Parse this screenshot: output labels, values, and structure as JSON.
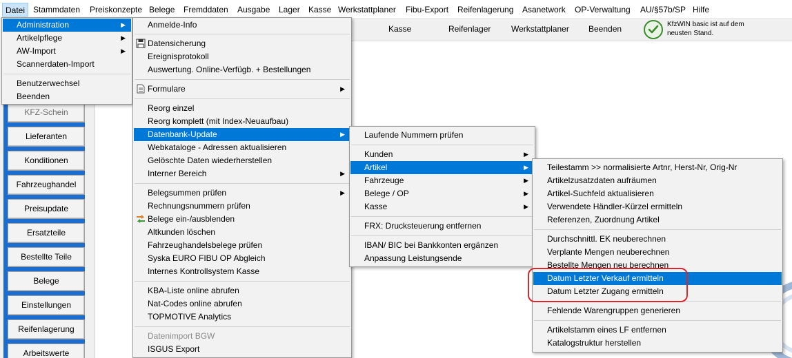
{
  "menubar": {
    "items": [
      "Datei",
      "Stammdaten",
      "Preiskonzepte",
      "Belege",
      "Fremddaten",
      "Ausgabe",
      "Lager",
      "Kasse",
      "Werkstattplaner",
      "Fibu-Export",
      "Reifenlagerung",
      "Asanetwork",
      "OP-Verwaltung",
      "AU/§57b/SP",
      "Hilfe"
    ]
  },
  "toolbar": {
    "buttons": [
      "Kasse",
      "Reifenlager",
      "Werkstattplaner",
      "Beenden"
    ],
    "status_line1": "KfzWIN basic ist auf dem",
    "status_line2": "neusten Stand."
  },
  "sidebar": {
    "buttons": [
      "KFZ-Schein",
      "Lieferanten",
      "Konditionen",
      "Fahrzeughandel",
      "Preisupdate",
      "Ersatzteile",
      "Bestellte Teile",
      "Belege",
      "Einstellungen",
      "Reifenlagerung",
      "Arbeitswerte"
    ]
  },
  "menu_datei": {
    "items": [
      "Administration",
      "Artikelpflege",
      "AW-Import",
      "Scannerdaten-Import",
      "Benutzerwechsel",
      "Beenden"
    ]
  },
  "menu_admin": {
    "items": [
      "Anmelde-Info",
      "Datensicherung",
      "Ereignisprotokoll",
      "Auswertung. Online-Verfügb. + Bestellungen",
      "Formulare",
      "Reorg einzel",
      "Reorg komplett (mit Index-Neuaufbau)",
      "Datenbank-Update",
      "Webkataloge - Adressen aktualisieren",
      "Gelöschte Daten wiederherstellen",
      "Interner Bereich",
      "Belegsummen prüfen",
      "Rechnungsnummern prüfen",
      "Belege ein-/ausblenden",
      "Altkunden löschen",
      "Fahrzeughandelsbelege prüfen",
      "Syska EURO FIBU OP Abgleich",
      "Internes Kontrollsystem Kasse",
      "KBA-Liste online abrufen",
      "Nat-Codes online abrufen",
      "TOPMOTIVE Analytics",
      "Datenimport BGW",
      "ISGUS Export"
    ]
  },
  "menu_dbupdate": {
    "items": [
      "Laufende Nummern prüfen",
      "Kunden",
      "Artikel",
      "Fahrzeuge",
      "Belege / OP",
      "Kasse",
      "FRX: Drucksteuerung entfernen",
      "IBAN/ BIC bei Bankkonten ergänzen",
      "Anpassung Leistungsende"
    ]
  },
  "menu_artikel": {
    "items": [
      "Teilestamm >> normalisierte Artnr, Herst-Nr, Orig-Nr",
      "Artikelzusatzdaten aufräumen",
      "Artikel-Suchfeld aktualisieren",
      "Verwendete Händler-Kürzel ermitteln",
      "Referenzen, Zuordnung Artikel",
      "Durchschnittl. EK neuberechnen",
      "Verplante Mengen neuberechnen",
      "Bestellte Mengen neu berechnen",
      "Datum Letzter Verkauf ermitteln",
      "Datum Letzter Zugang ermitteln",
      "Fehlende Warengruppen generieren",
      "Artikelstamm eines LF entfernen",
      "Katalogstruktur herstellen"
    ]
  },
  "colors": {
    "highlight": "#0078d7",
    "sidebar_panel": "#1c6dd0",
    "annotation": "#d9262b",
    "status_ok": "#3a8a2e"
  }
}
